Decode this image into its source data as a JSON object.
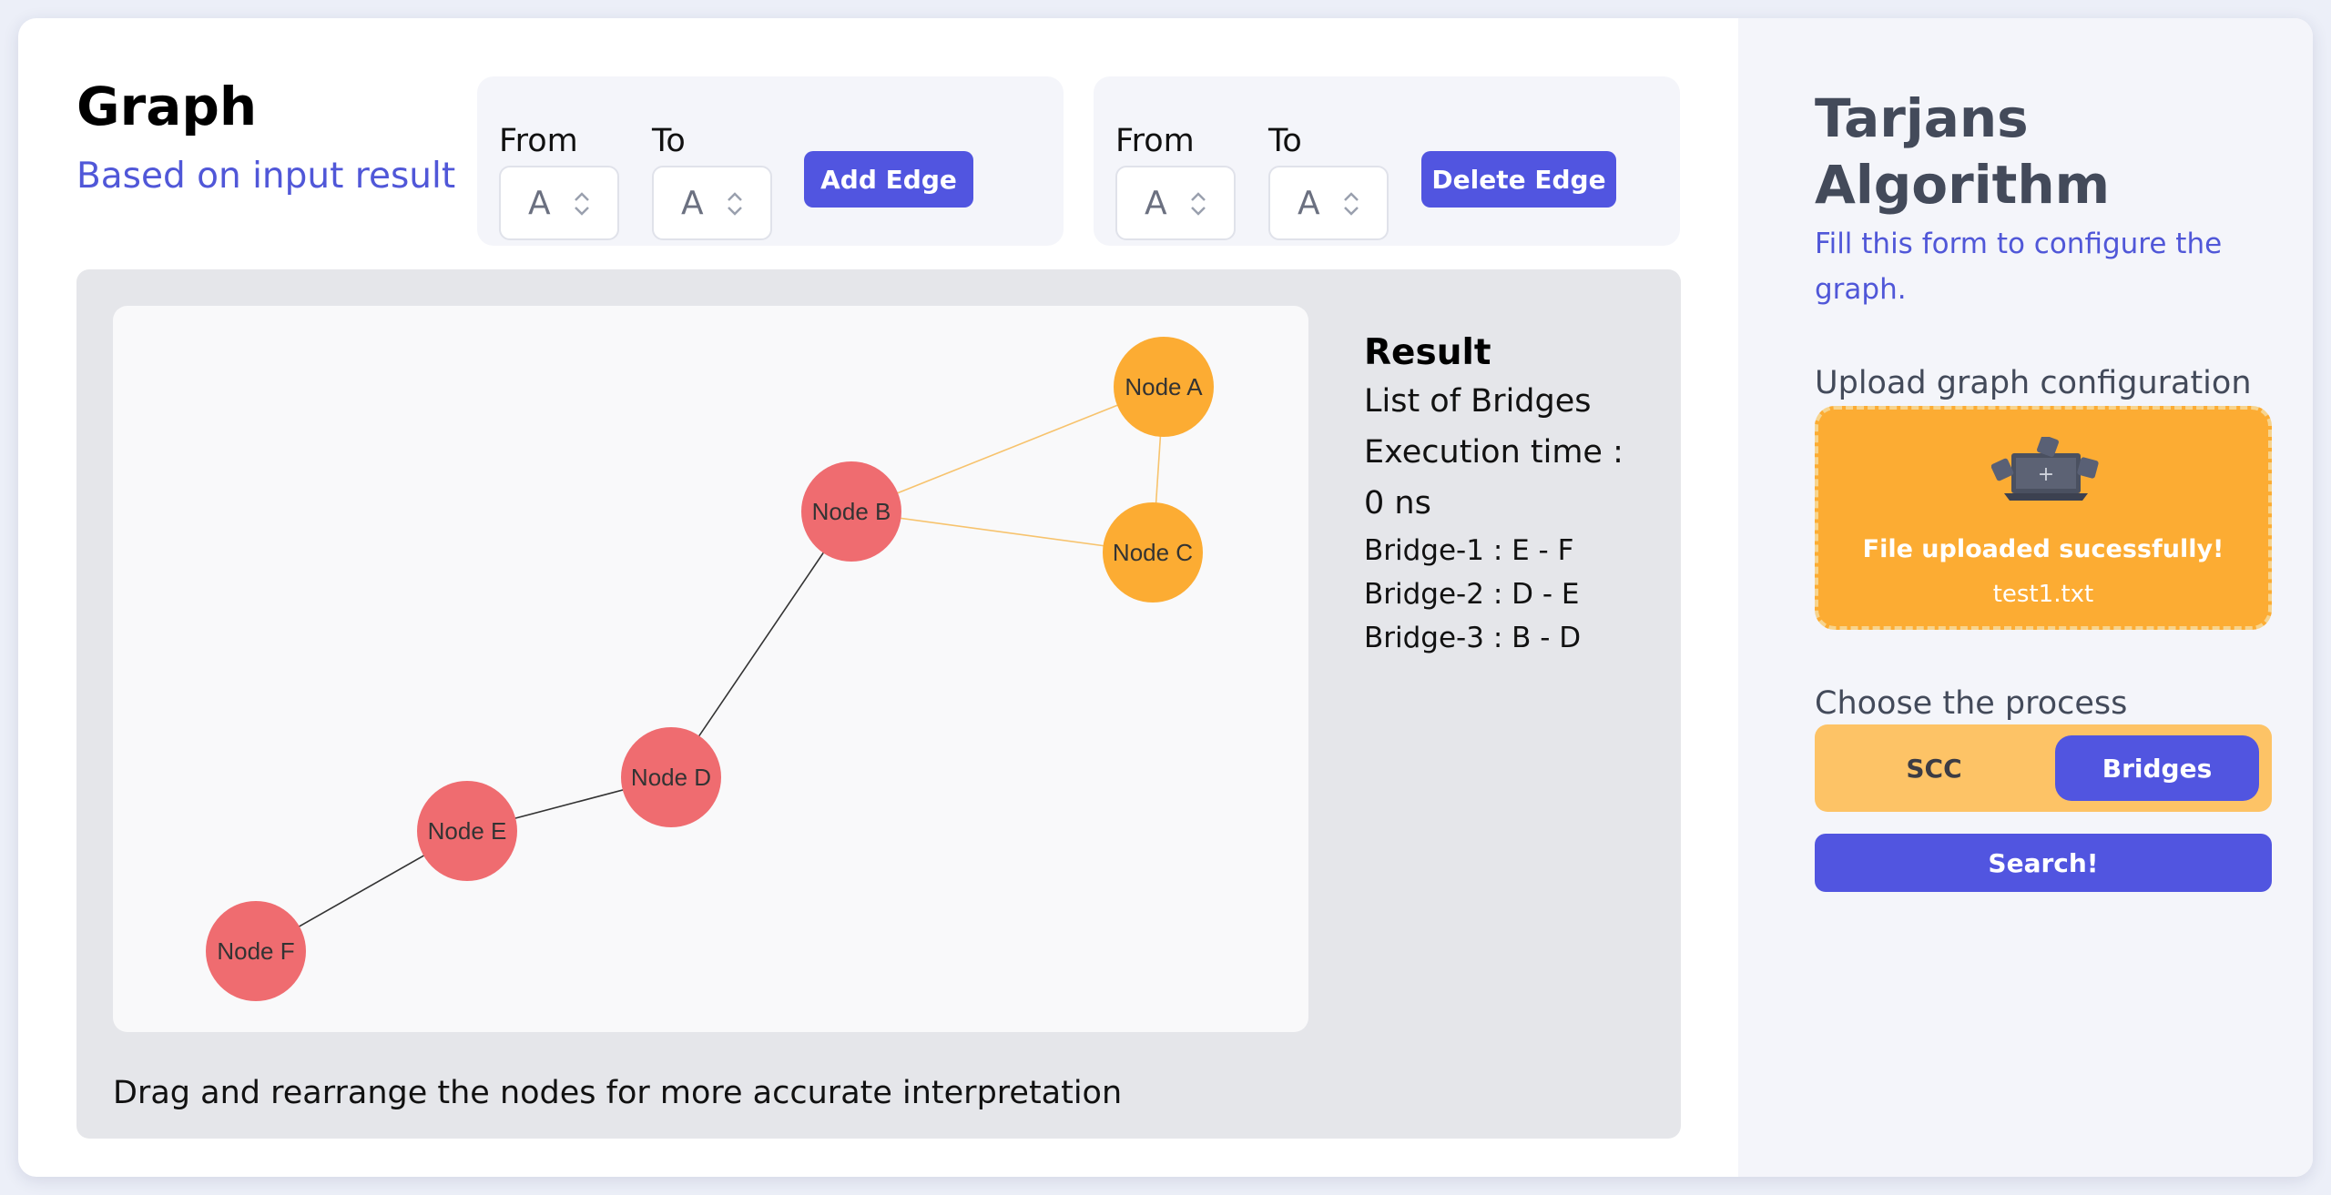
{
  "header": {
    "title": "Graph",
    "subtitle": "Based on input result"
  },
  "add_edge": {
    "from_label": "From",
    "to_label": "To",
    "from_value": "A",
    "to_value": "A",
    "button": "Add Edge"
  },
  "delete_edge": {
    "from_label": "From",
    "to_label": "To",
    "from_value": "A",
    "to_value": "A",
    "button": "Delete Edge"
  },
  "graph": {
    "nodes": [
      {
        "id": "A",
        "label": "Node A",
        "color": "#fcac33"
      },
      {
        "id": "B",
        "label": "Node B",
        "color": "#ef6c70"
      },
      {
        "id": "C",
        "label": "Node C",
        "color": "#fcac33"
      },
      {
        "id": "D",
        "label": "Node D",
        "color": "#ef6c70"
      },
      {
        "id": "E",
        "label": "Node E",
        "color": "#ef6c70"
      },
      {
        "id": "F",
        "label": "Node F",
        "color": "#ef6c70"
      }
    ],
    "edges": [
      {
        "from": "A",
        "to": "B",
        "color": "#f7c36d"
      },
      {
        "from": "A",
        "to": "C",
        "color": "#f7c36d"
      },
      {
        "from": "B",
        "to": "C",
        "color": "#f7c36d"
      },
      {
        "from": "B",
        "to": "D",
        "color": "#333333"
      },
      {
        "from": "D",
        "to": "E",
        "color": "#333333"
      },
      {
        "from": "E",
        "to": "F",
        "color": "#333333"
      }
    ],
    "hint": "Drag and rearrange the nodes for more accurate interpretation"
  },
  "result": {
    "title": "Result",
    "list_title": "List of Bridges",
    "exec_label": "Execution time :",
    "exec_value": "0 ns",
    "bridges": [
      "Bridge-1 : E - F",
      "Bridge-2 : D - E",
      "Bridge-3 : B - D"
    ]
  },
  "sidebar": {
    "title": "Tarjans Algorithm",
    "subtitle": "Fill this form to configure the graph.",
    "upload_label": "Upload graph configuration",
    "upload_message": "File uploaded sucessfully!",
    "upload_filename": "test1.txt",
    "process_label": "Choose the process",
    "process_options": [
      "SCC",
      "Bridges"
    ],
    "process_selected": "Bridges",
    "search_button": "Search!"
  },
  "colors": {
    "accent": "#5155e0",
    "orange": "#fcac33",
    "red": "#ef6c70"
  }
}
